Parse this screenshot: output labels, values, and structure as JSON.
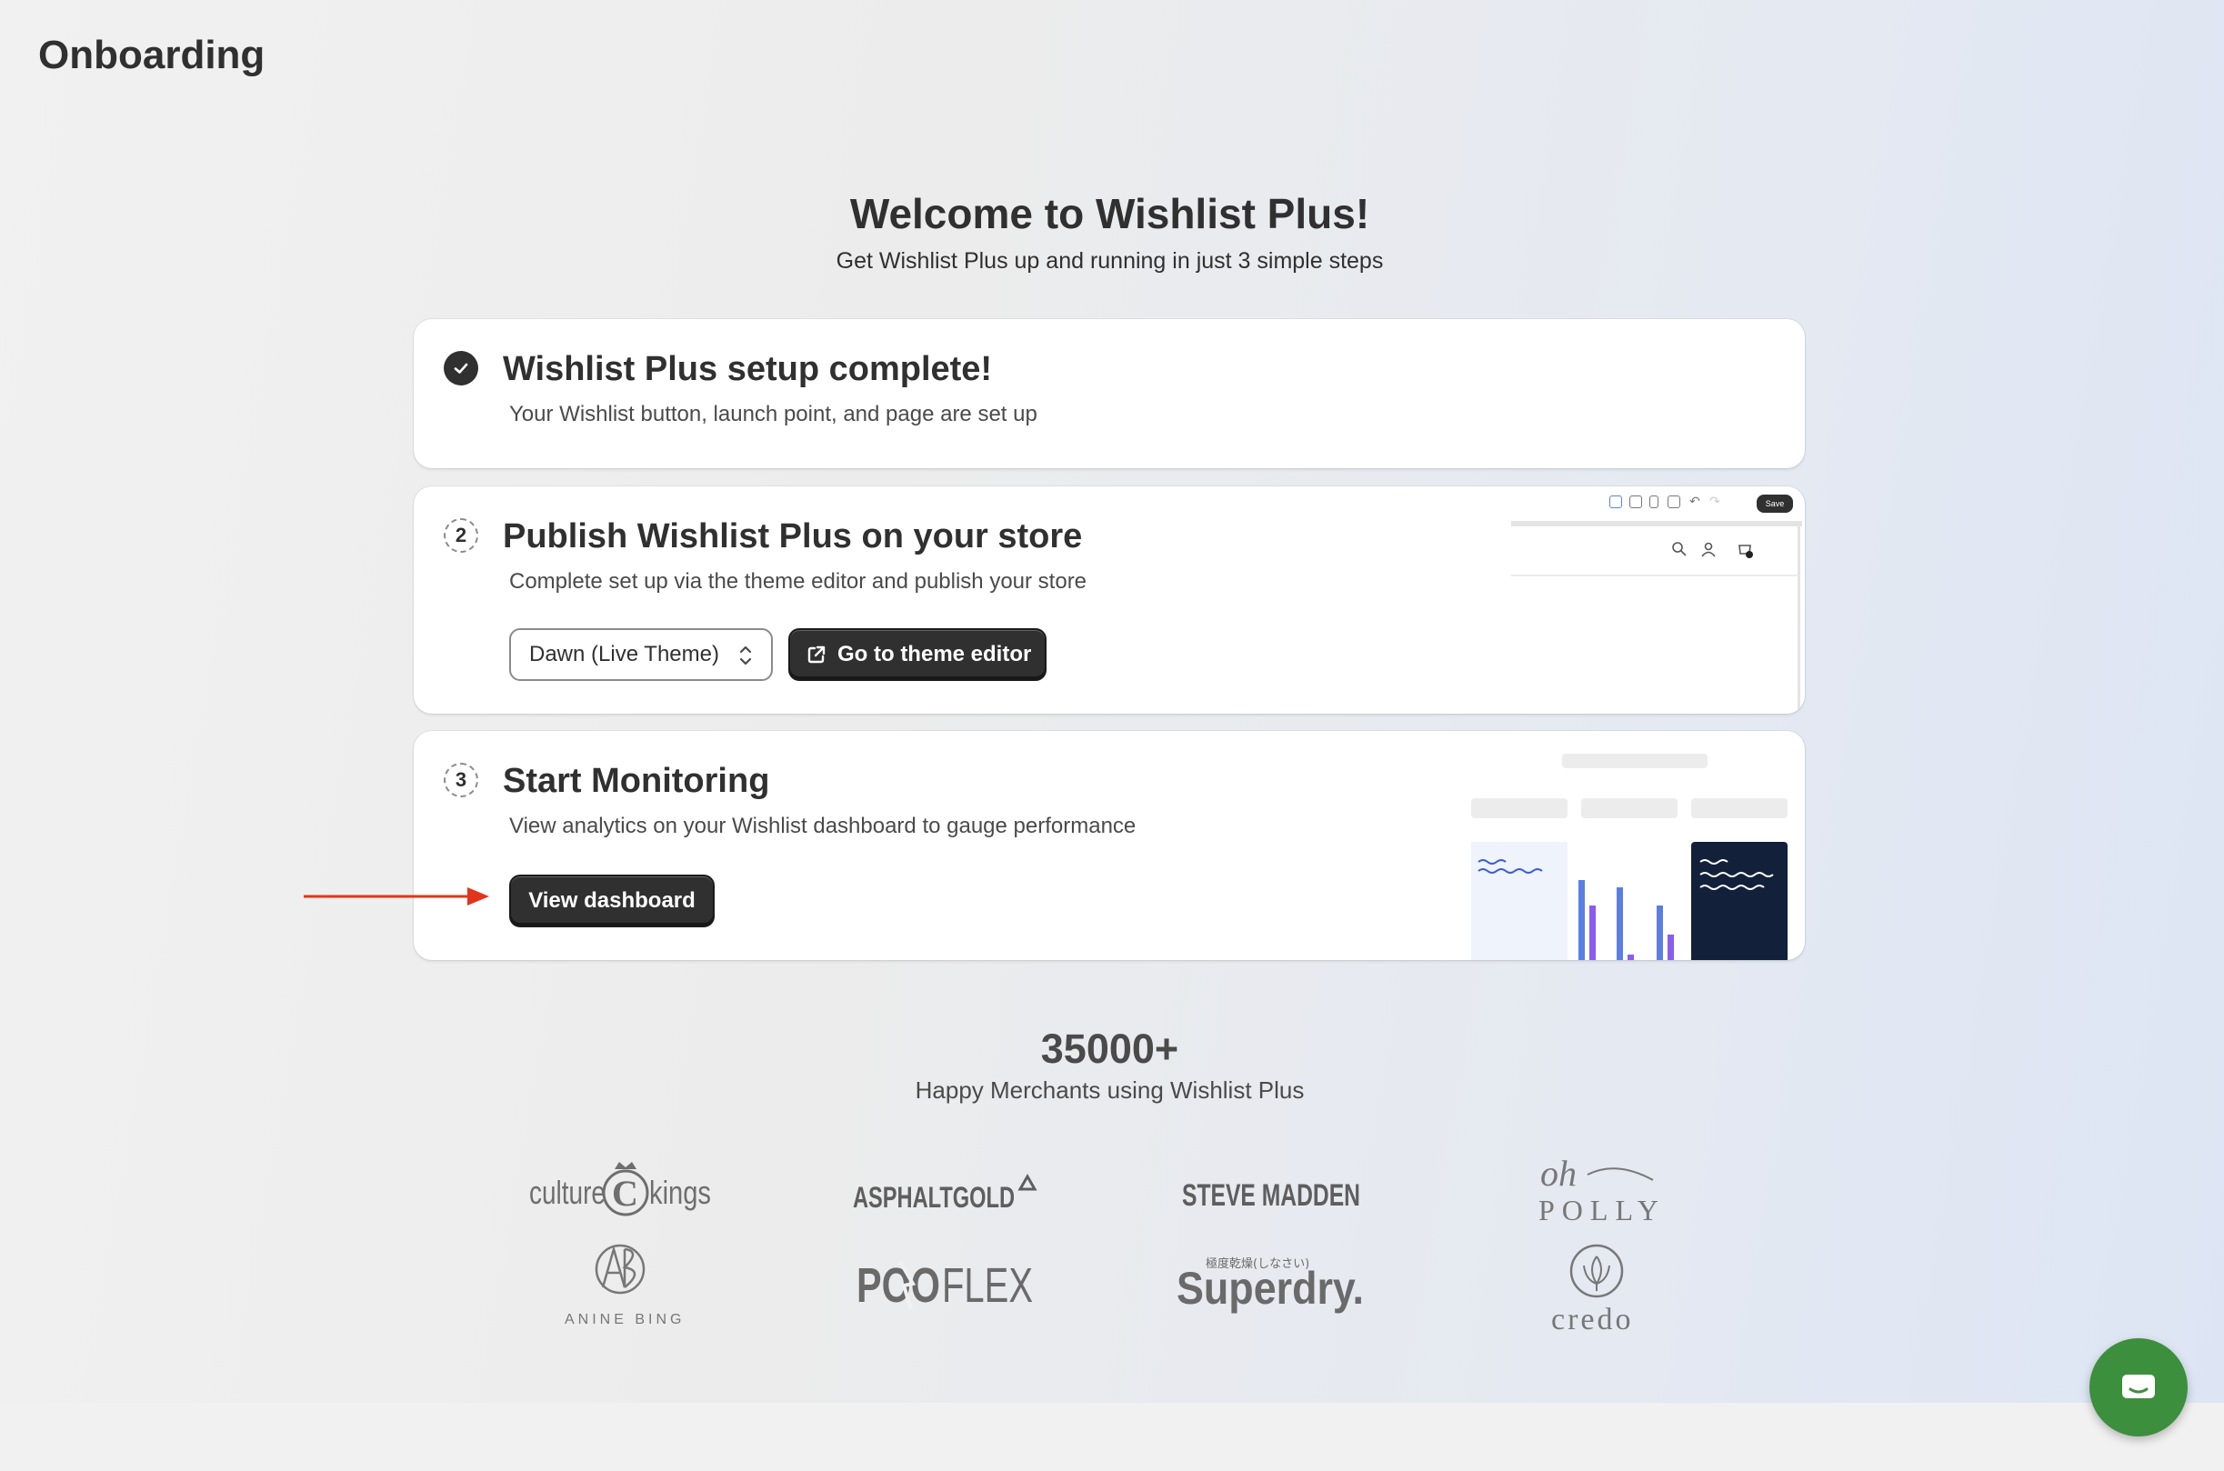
{
  "page": {
    "title": "Onboarding"
  },
  "hero": {
    "title": "Welcome to Wishlist Plus!",
    "subtitle": "Get Wishlist Plus up and running in just 3 simple steps"
  },
  "steps": [
    {
      "status": "complete",
      "title": "Wishlist Plus setup complete!",
      "description": "Your Wishlist button, launch point, and page are set up"
    },
    {
      "number": "2",
      "title": "Publish Wishlist Plus on your store",
      "description": "Complete set up via the theme editor and publish your store",
      "theme_select": "Dawn (Live Theme)",
      "button": "Go to theme editor",
      "preview_save": "Save"
    },
    {
      "number": "3",
      "title": "Start Monitoring",
      "description": "View analytics on your Wishlist dashboard to gauge performance",
      "button": "View dashboard"
    }
  ],
  "stats": {
    "value": "35000+",
    "label": "Happy Merchants using Wishlist Plus"
  },
  "merchant_logos": [
    "culture kings",
    "ASPHALTGOLD",
    "STEVE MADDEN",
    "oh POLLY",
    "ANINE BING",
    "POOFLEX",
    "Superdry.",
    "credo"
  ],
  "superdry_tagline": "極度乾燥(しなさい)",
  "colors": {
    "accent_dark": "#303030",
    "arrow": "#e2341d",
    "chat": "#3c8f3c",
    "bar_blue": "#5b7ee5",
    "bar_purple": "#8a5cf0"
  },
  "icons": [
    "check-icon",
    "chevron-updown-icon",
    "external-link-icon",
    "chat-icon"
  ]
}
